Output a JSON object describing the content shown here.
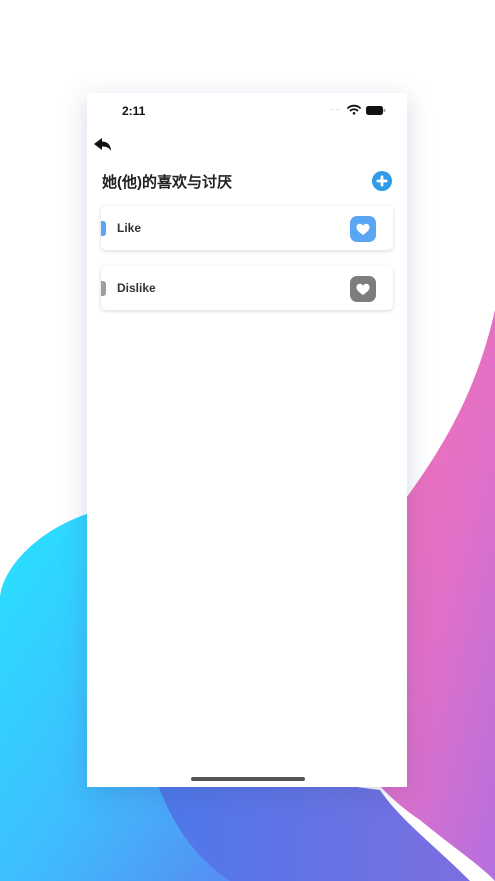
{
  "status_bar": {
    "time": "2:11",
    "signal_dots": "....",
    "wifi_icon": "wifi-icon",
    "battery_icon": "battery-icon"
  },
  "nav": {
    "back_icon": "back-arrow-icon",
    "title": "她(他)的喜欢与讨厌",
    "add_icon": "plus-circle-icon"
  },
  "cards": [
    {
      "label": "Like",
      "accent_color": "#5aa6f2",
      "icon": "heart-icon"
    },
    {
      "label": "Dislike",
      "accent_color": "#9e9e9e",
      "icon": "heart-icon"
    }
  ],
  "colors": {
    "add_button": "#2f9be9",
    "like_accent": "#5aa6f2",
    "dislike_accent": "#9e9e9e",
    "icon_dislike_bg": "#7d7d7d"
  }
}
